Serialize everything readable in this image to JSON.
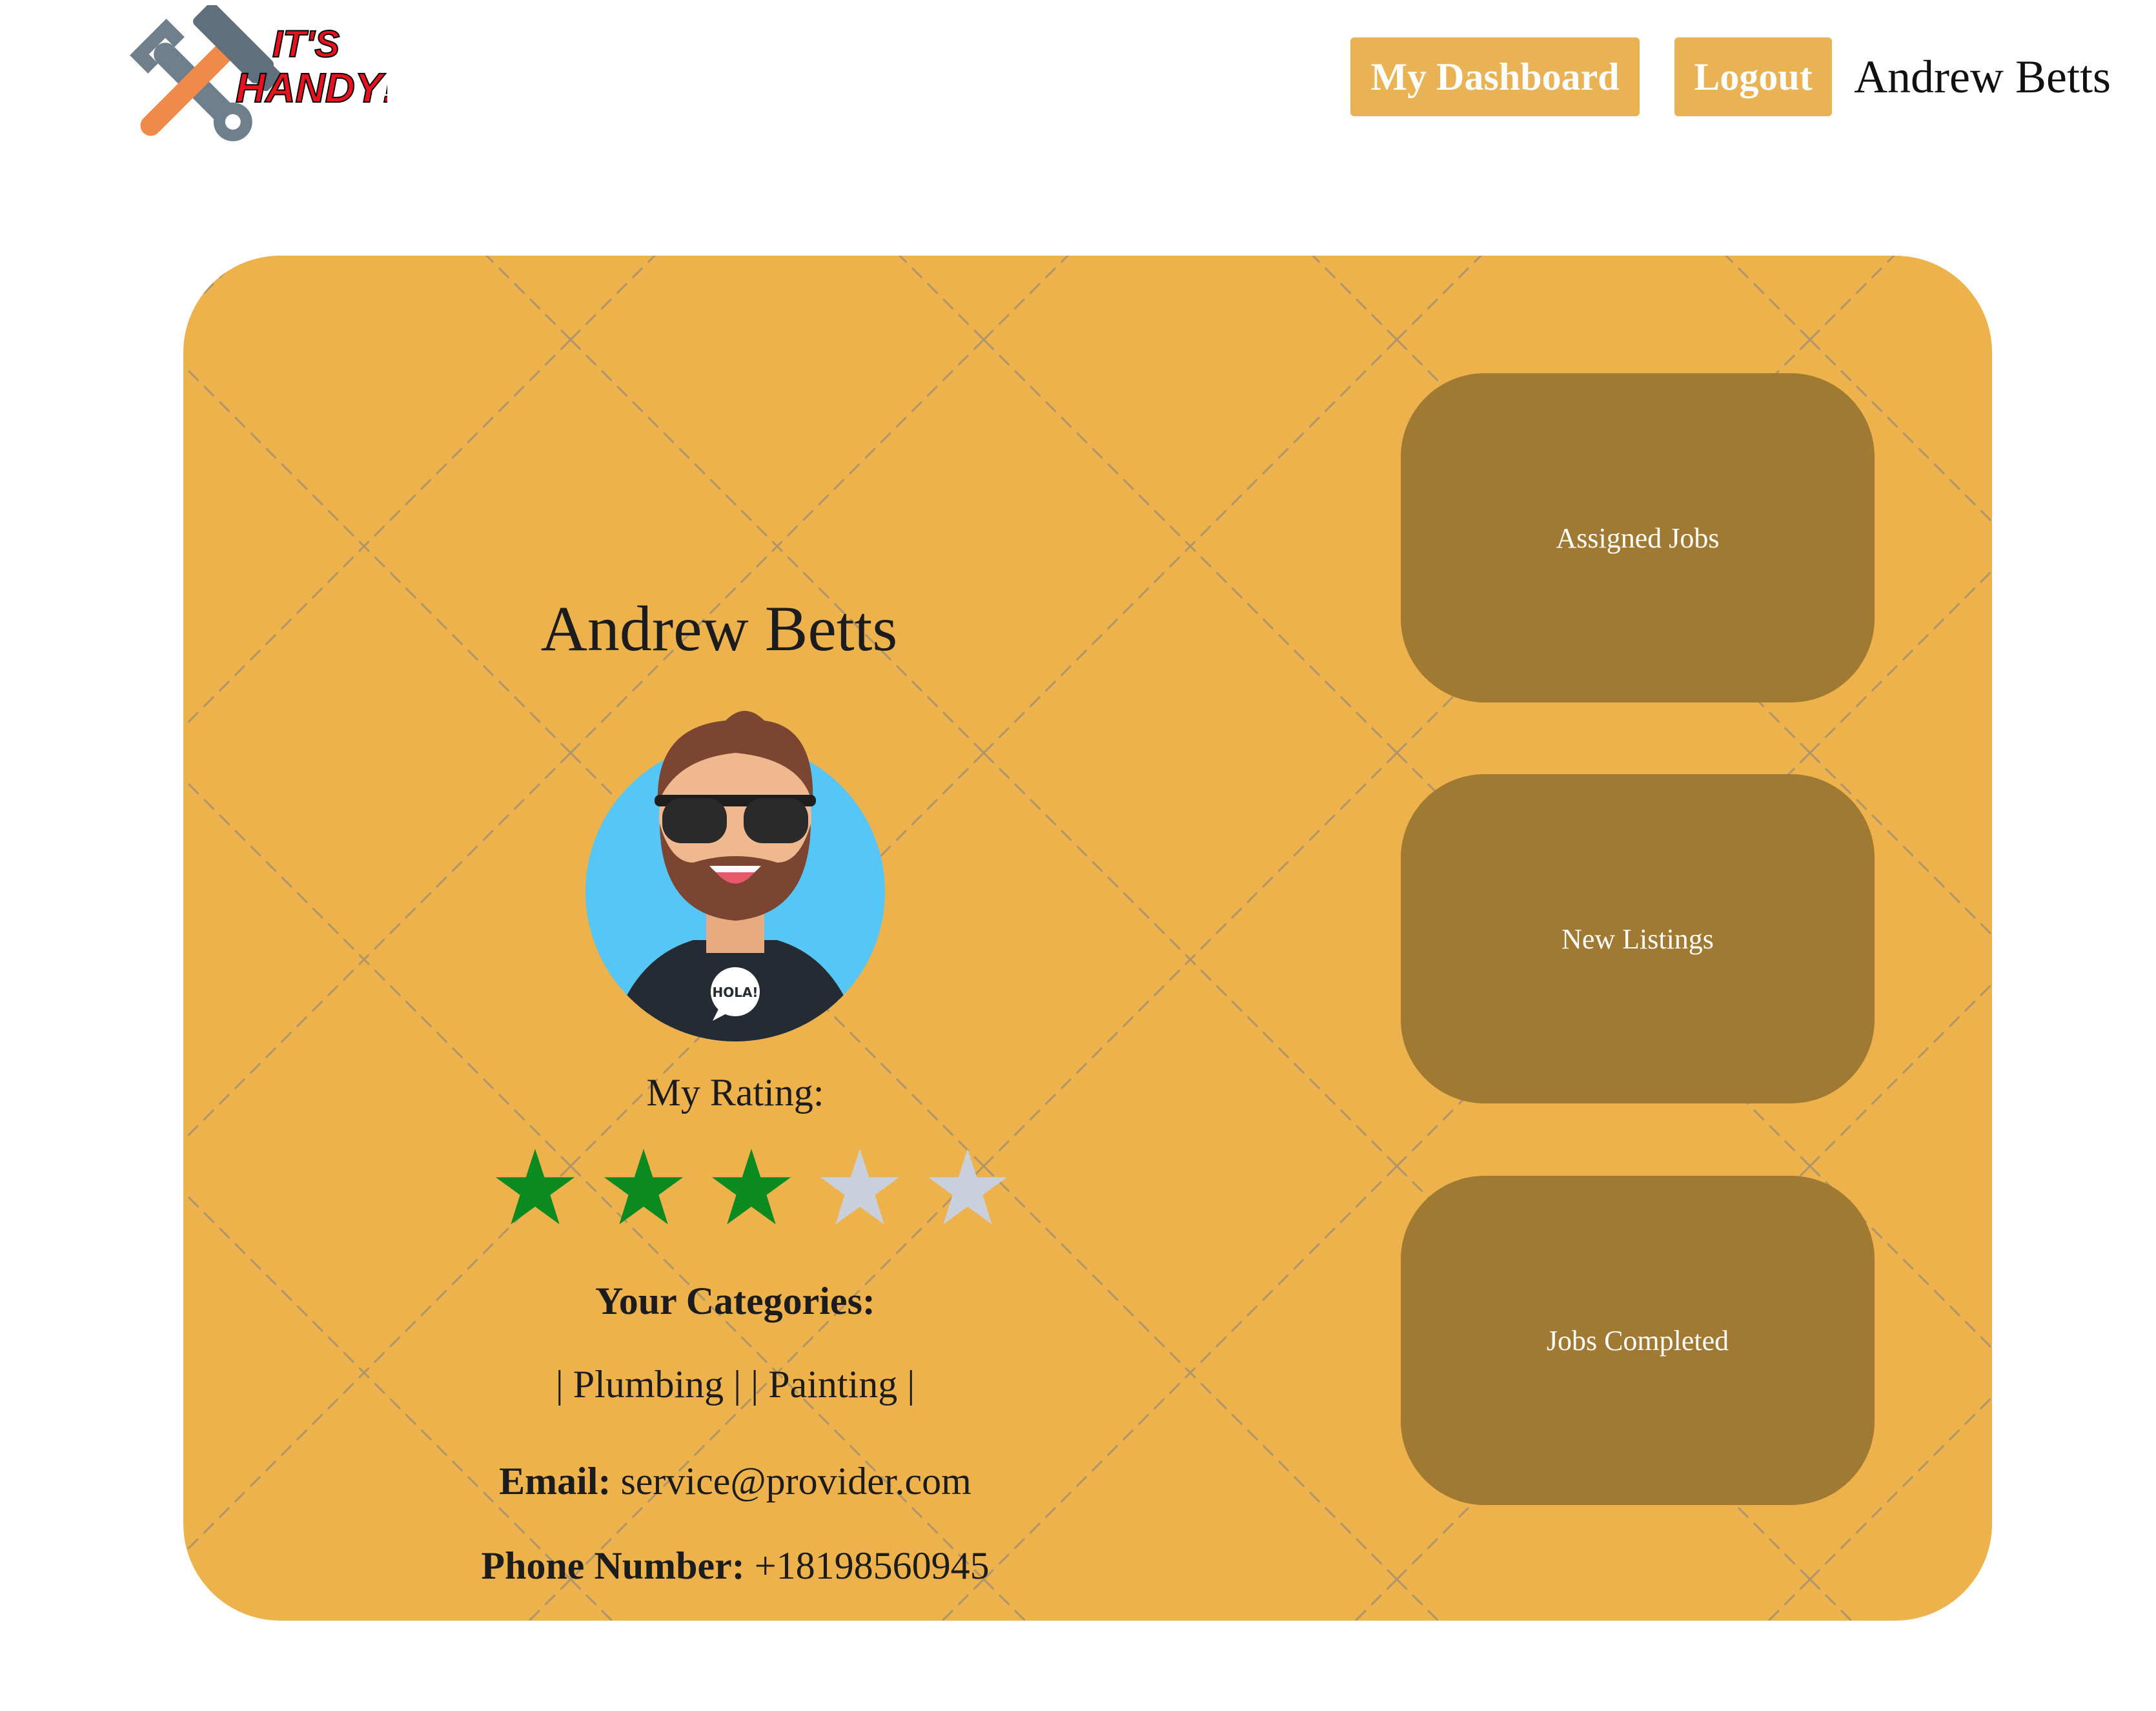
{
  "brand": {
    "logo_line1": "IT'S",
    "logo_line2": "HANDY!",
    "logo_icon": "hammer-wrench-icon"
  },
  "header": {
    "dashboard_label": "My Dashboard",
    "logout_label": "Logout",
    "user_name": "Andrew Betts",
    "button_color": "#e9b254"
  },
  "profile": {
    "name": "Andrew Betts",
    "avatar_icon": "bearded-man-sunglasses-avatar",
    "avatar_badge": "HOLA!",
    "rating_label": "My Rating:",
    "rating": 3,
    "rating_max": 5,
    "categories_title": "Your Categories:",
    "categories_text": "| Plumbing | | Painting |",
    "email_label": "Email:",
    "email": "service@provider.com",
    "phone_label": "Phone Number:",
    "phone": "+18198560945",
    "card_color": "#edb24c",
    "star_filled_color": "#0a8a1f",
    "star_empty_color": "#c9cfdb"
  },
  "tiles": [
    {
      "label": "Assigned Jobs"
    },
    {
      "label": "New Listings"
    },
    {
      "label": "Jobs Completed"
    }
  ],
  "tile_color": "#a07932"
}
